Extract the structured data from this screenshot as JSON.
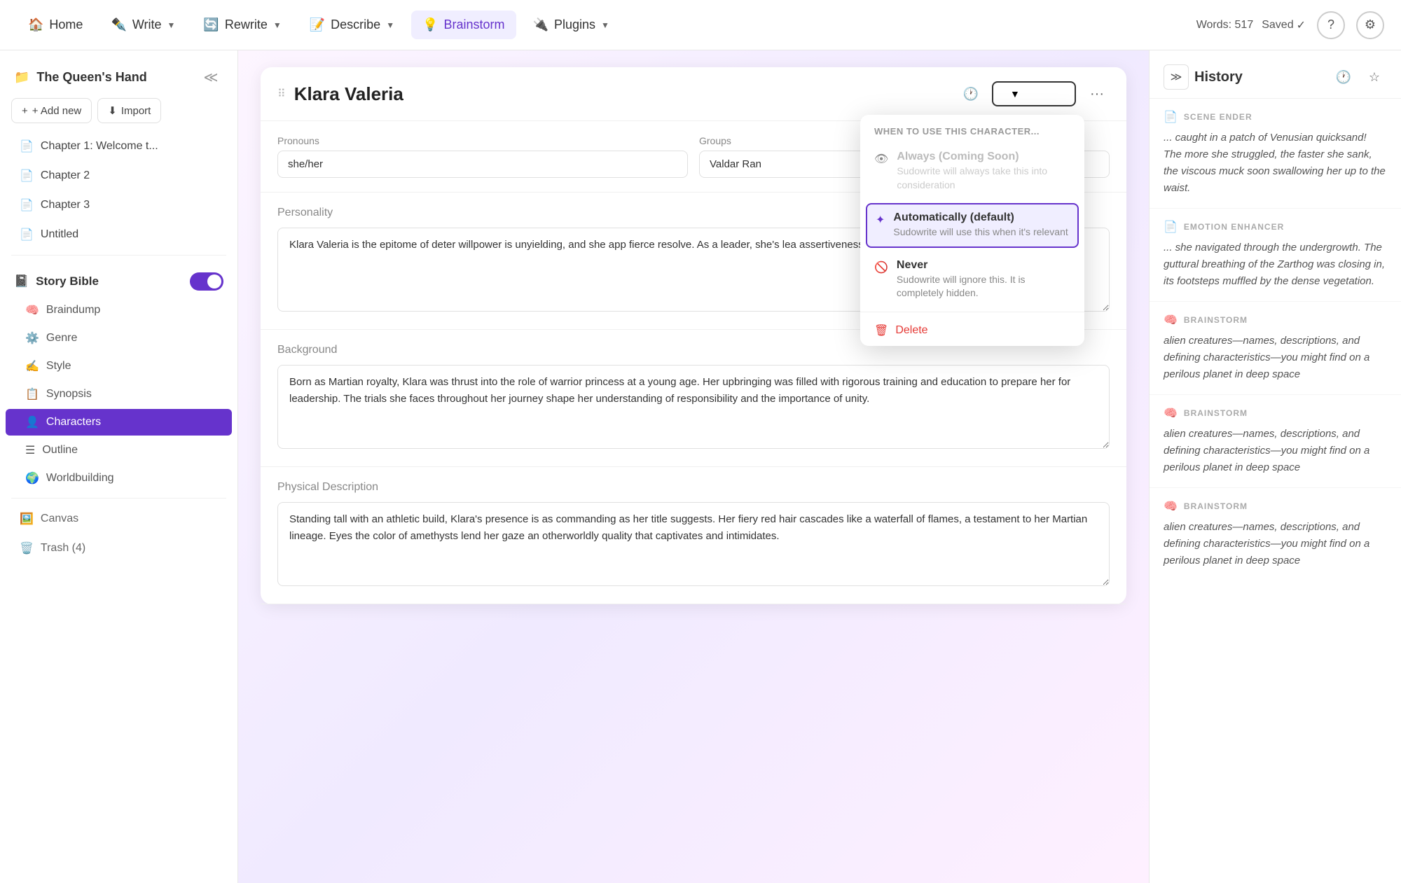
{
  "toolbar": {
    "home_label": "Home",
    "write_label": "Write",
    "rewrite_label": "Rewrite",
    "describe_label": "Describe",
    "brainstorm_label": "Brainstorm",
    "plugins_label": "Plugins",
    "words_label": "Words: 517",
    "saved_label": "Saved"
  },
  "sidebar": {
    "project_title": "The Queen's Hand",
    "add_new_label": "+ Add new",
    "import_label": "Import",
    "chapters": [
      {
        "label": "Chapter 1: Welcome t...",
        "icon": "📄"
      },
      {
        "label": "Chapter 2",
        "icon": "📄"
      },
      {
        "label": "Chapter 3",
        "icon": "📄"
      },
      {
        "label": "Untitled",
        "icon": "📄"
      }
    ],
    "story_bible_label": "Story Bible",
    "story_bible_items": [
      {
        "label": "Braindump",
        "icon": "🧠"
      },
      {
        "label": "Genre",
        "icon": "⚙️"
      },
      {
        "label": "Style",
        "icon": "✍️"
      },
      {
        "label": "Synopsis",
        "icon": "📋"
      },
      {
        "label": "Characters",
        "icon": "👤",
        "active": true
      },
      {
        "label": "Outline",
        "icon": "☰"
      },
      {
        "label": "Worldbuilding",
        "icon": "🌍"
      }
    ],
    "canvas_label": "Canvas",
    "trash_label": "Trash (4)"
  },
  "character": {
    "name": "Klara Valeria",
    "pronouns_label": "Pronouns",
    "pronouns_value": "she/her",
    "groups_label": "Groups",
    "groups_value": "Valdar Ran",
    "personality_label": "Personality",
    "personality_text": "Klara Valeria is the epitome of deter willpower is unyielding, and she app fierce resolve. As a leader, she's lea assertiveness and empathy, growin she overcomes.",
    "background_label": "Background",
    "background_text": "Born as Martian royalty, Klara was thrust into the role of warrior princess at a young age. Her upbringing was filled with rigorous training and education to prepare her for leadership. The trials she faces throughout her journey shape her understanding of responsibility and the importance of unity.",
    "physical_label": "Physical Description",
    "physical_text": "Standing tall with an athletic build, Klara's presence is as commanding as her title suggests. Her fiery red hair cascades like a waterfall of flames, a testament to her Martian lineage. Eyes the color of amethysts lend her gaze an otherworldly quality that captivates and intimidates."
  },
  "dropdown": {
    "title": "WHEN TO USE THIS CHARACTER...",
    "options": [
      {
        "label": "Always (Coming Soon)",
        "desc": "Sudowrite will always take this into consideration",
        "icon": "👁",
        "disabled": true
      },
      {
        "label": "Automatically (default)",
        "desc": "Sudowrite will use this when it's relevant",
        "icon": "✦",
        "selected": true
      },
      {
        "label": "Never",
        "desc": "Sudowrite will ignore this. It is completely hidden.",
        "icon": "🚫",
        "disabled": false
      }
    ],
    "delete_label": "Delete"
  },
  "history": {
    "title": "History",
    "items": [
      {
        "category": "SCENE ENDER",
        "icon": "📄",
        "text": "... caught in a patch of Venusian quicksand! The more she struggled, the faster she sank, the viscous muck soon swallowing her up to the waist."
      },
      {
        "category": "EMOTION ENHANCER",
        "icon": "📄",
        "text": "... she navigated through the undergrowth. The guttural breathing of the Zarthog was closing in, its footsteps muffled by the dense vegetation."
      },
      {
        "category": "BRAINSTORM",
        "icon": "🧠",
        "text": "alien creatures—names, descriptions, and defining characteristics—you might find on a perilous planet in deep space"
      },
      {
        "category": "BRAINSTORM",
        "icon": "🧠",
        "text": "alien creatures—names, descriptions, and defining characteristics—you might find on a perilous planet in deep space"
      },
      {
        "category": "BRAINSTORM",
        "icon": "🧠",
        "text": "alien creatures—names, descriptions, and defining characteristics—you might find on a perilous planet in deep space"
      }
    ]
  }
}
